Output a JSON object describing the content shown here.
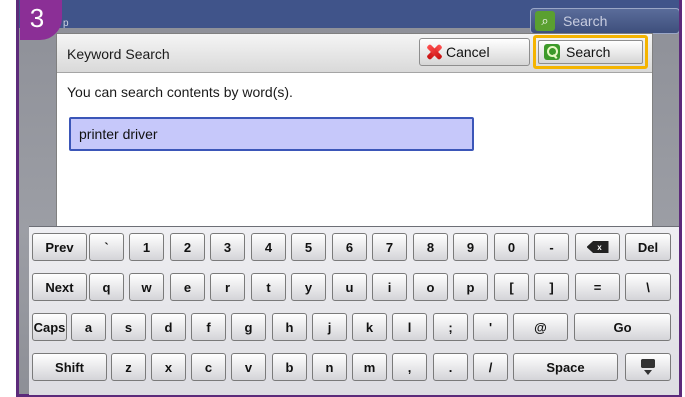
{
  "step": {
    "number": "3"
  },
  "background": {
    "search_label": "Search",
    "left_char": "p"
  },
  "dialog": {
    "title": "Keyword Search",
    "cancel_label": "Cancel",
    "search_label": "Search",
    "description": "You can search contents by word(s).",
    "input_value": "printer driver"
  },
  "keyboard": {
    "row1": [
      "Prev",
      "`",
      "1",
      "2",
      "3",
      "4",
      "5",
      "6",
      "7",
      "8",
      "9",
      "0",
      "-",
      "backspace",
      "Del"
    ],
    "row2": [
      "Next",
      "q",
      "w",
      "e",
      "r",
      "t",
      "y",
      "u",
      "i",
      "o",
      "p",
      "[",
      "]",
      "=",
      "\\"
    ],
    "row3": [
      "Caps",
      "a",
      "s",
      "d",
      "f",
      "g",
      "h",
      "j",
      "k",
      "l",
      ";",
      "'",
      "@",
      "Go"
    ],
    "row4": [
      "Shift",
      "z",
      "x",
      "c",
      "v",
      "b",
      "n",
      "m",
      ",",
      ".",
      "/",
      "Space",
      "keyboard-hide"
    ],
    "backspace_glyph": "x"
  },
  "colors": {
    "step_badge": "#8b2f96",
    "input_bg": "#c6c8fa",
    "input_border": "#3b56b8",
    "highlight": "#f5b400"
  }
}
